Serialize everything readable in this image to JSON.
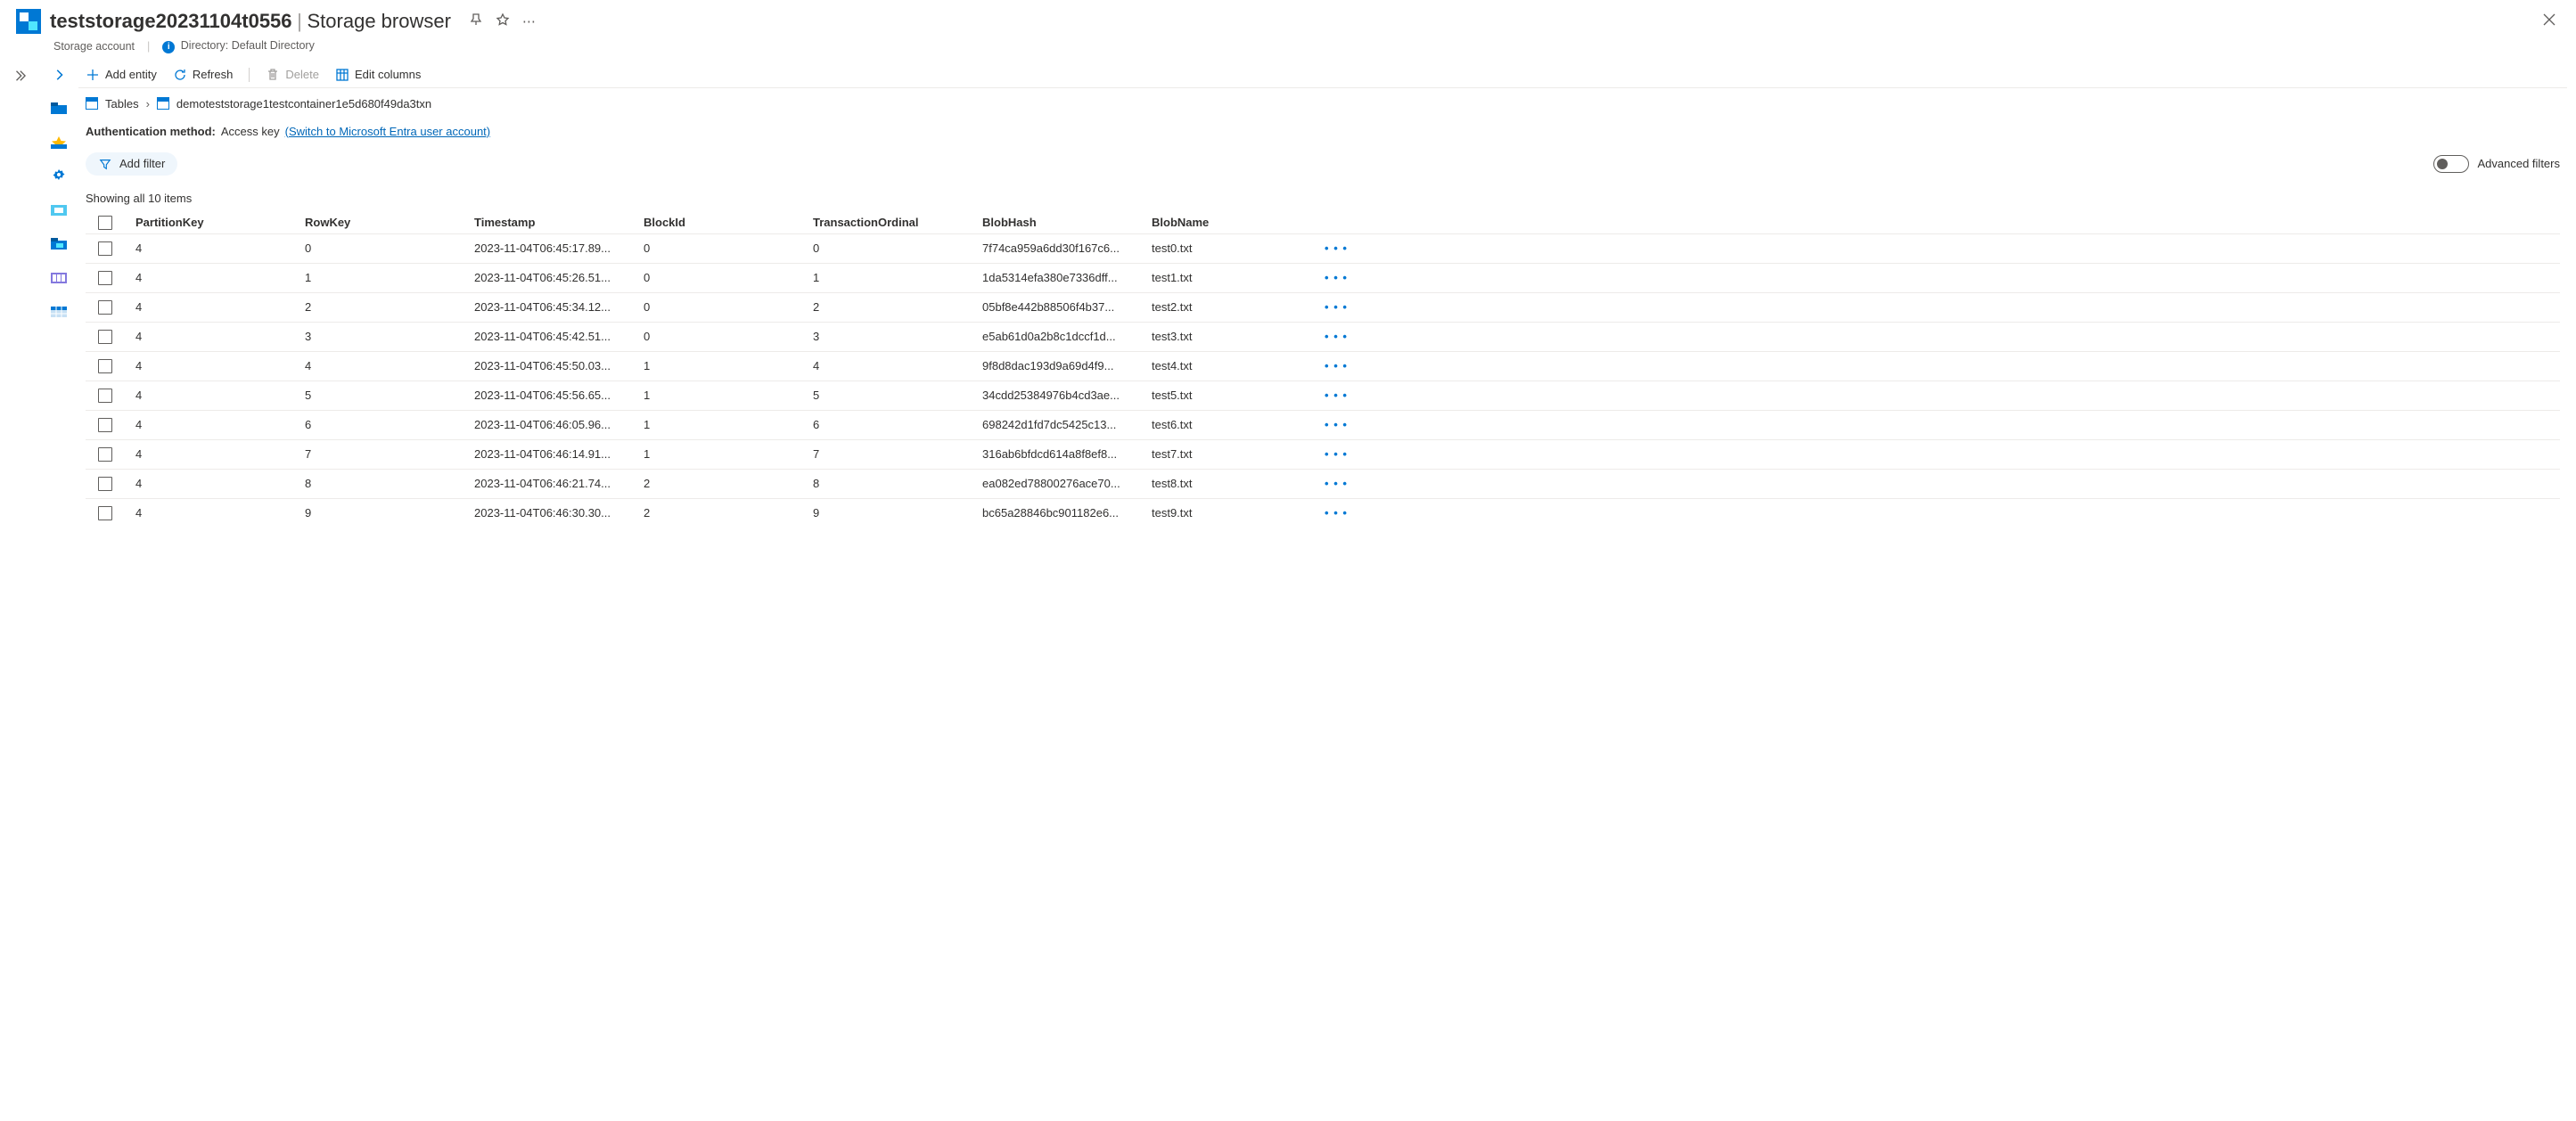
{
  "header": {
    "title": "teststorage20231104t0556",
    "subtitle": "Storage browser",
    "resourceType": "Storage account",
    "directoryLabel": "Directory: Default Directory"
  },
  "toolbar": {
    "addEntity": "Add entity",
    "refresh": "Refresh",
    "delete": "Delete",
    "editColumns": "Edit columns"
  },
  "breadcrumb": {
    "root": "Tables",
    "current": "demoteststorage1testcontainer1e5d680f49da3txn"
  },
  "auth": {
    "label": "Authentication method:",
    "value": "Access key",
    "switchLink": "(Switch to Microsoft Entra user account)"
  },
  "filter": {
    "addFilter": "Add filter",
    "advancedFilters": "Advanced filters"
  },
  "status": "Showing all 10 items",
  "columns": [
    "PartitionKey",
    "RowKey",
    "Timestamp",
    "BlockId",
    "TransactionOrdinal",
    "BlobHash",
    "BlobName"
  ],
  "rows": [
    {
      "PartitionKey": "4",
      "RowKey": "0",
      "Timestamp": "2023-11-04T06:45:17.89...",
      "BlockId": "0",
      "TransactionOrdinal": "0",
      "BlobHash": "7f74ca959a6dd30f167c6...",
      "BlobName": "test0.txt"
    },
    {
      "PartitionKey": "4",
      "RowKey": "1",
      "Timestamp": "2023-11-04T06:45:26.51...",
      "BlockId": "0",
      "TransactionOrdinal": "1",
      "BlobHash": "1da5314efa380e7336dff...",
      "BlobName": "test1.txt"
    },
    {
      "PartitionKey": "4",
      "RowKey": "2",
      "Timestamp": "2023-11-04T06:45:34.12...",
      "BlockId": "0",
      "TransactionOrdinal": "2",
      "BlobHash": "05bf8e442b88506f4b37...",
      "BlobName": "test2.txt"
    },
    {
      "PartitionKey": "4",
      "RowKey": "3",
      "Timestamp": "2023-11-04T06:45:42.51...",
      "BlockId": "0",
      "TransactionOrdinal": "3",
      "BlobHash": "e5ab61d0a2b8c1dccf1d...",
      "BlobName": "test3.txt"
    },
    {
      "PartitionKey": "4",
      "RowKey": "4",
      "Timestamp": "2023-11-04T06:45:50.03...",
      "BlockId": "1",
      "TransactionOrdinal": "4",
      "BlobHash": "9f8d8dac193d9a69d4f9...",
      "BlobName": "test4.txt"
    },
    {
      "PartitionKey": "4",
      "RowKey": "5",
      "Timestamp": "2023-11-04T06:45:56.65...",
      "BlockId": "1",
      "TransactionOrdinal": "5",
      "BlobHash": "34cdd25384976b4cd3ae...",
      "BlobName": "test5.txt"
    },
    {
      "PartitionKey": "4",
      "RowKey": "6",
      "Timestamp": "2023-11-04T06:46:05.96...",
      "BlockId": "1",
      "TransactionOrdinal": "6",
      "BlobHash": "698242d1fd7dc5425c13...",
      "BlobName": "test6.txt"
    },
    {
      "PartitionKey": "4",
      "RowKey": "7",
      "Timestamp": "2023-11-04T06:46:14.91...",
      "BlockId": "1",
      "TransactionOrdinal": "7",
      "BlobHash": "316ab6bfdcd614a8f8ef8...",
      "BlobName": "test7.txt"
    },
    {
      "PartitionKey": "4",
      "RowKey": "8",
      "Timestamp": "2023-11-04T06:46:21.74...",
      "BlockId": "2",
      "TransactionOrdinal": "8",
      "BlobHash": "ea082ed78800276ace70...",
      "BlobName": "test8.txt"
    },
    {
      "PartitionKey": "4",
      "RowKey": "9",
      "Timestamp": "2023-11-04T06:46:30.30...",
      "BlockId": "2",
      "TransactionOrdinal": "9",
      "BlobHash": "bc65a28846bc901182e6...",
      "BlobName": "test9.txt"
    }
  ]
}
